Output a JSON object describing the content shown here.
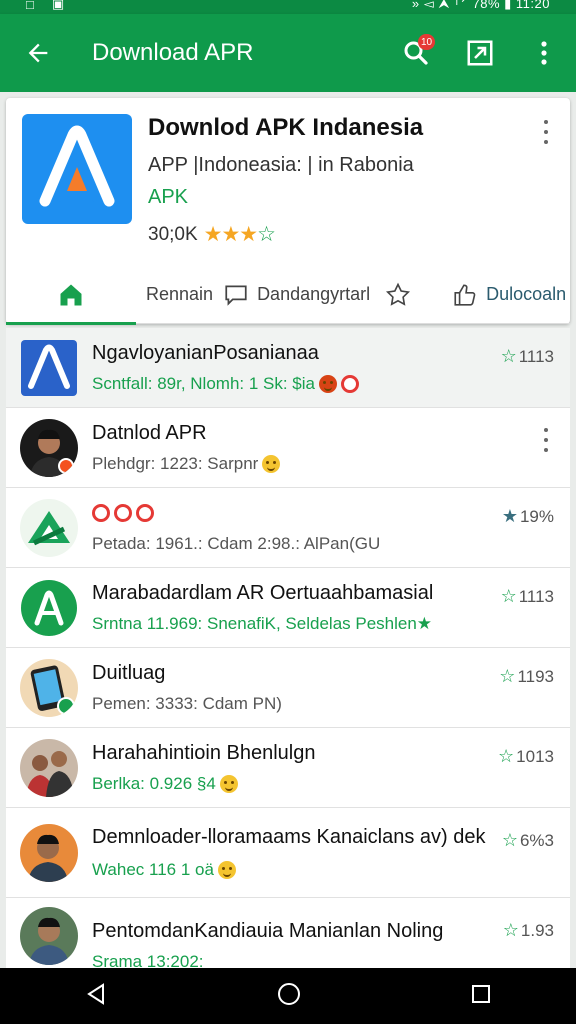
{
  "status_bar": {
    "right_text": "» ◅ ⮝ ᵀ⸍ 78% ▮ 11:20"
  },
  "appbar": {
    "title": "Download APR",
    "notification_count": "10"
  },
  "app": {
    "name": "Downlod APK Indanesia",
    "subtitle": "APP |Indoneasia: | in Rabonia",
    "category": "APK",
    "rating_text": "30;0K"
  },
  "tabs": [
    {
      "label": ""
    },
    {
      "label": "Rennain"
    },
    {
      "label": "Dandangyrtarl"
    },
    {
      "label": "Dulocoaln"
    }
  ],
  "list": [
    {
      "title": "NgavloyanianPosanianaa",
      "subtitle": "Scntfall: 89r, Nlomh: 1 Sk: $ia",
      "rating": "1113"
    },
    {
      "title": "Datnlod APR",
      "subtitle": "Plehdgr: 1223: Sarpnr"
    },
    {
      "title": "",
      "subtitle": "Petada: 1961.: Cdam 2:98.: AlPan(GU",
      "rating": "19%"
    },
    {
      "title": "Marabadardlam AR Oertuaahbamasial",
      "subtitle": "Srntna 11.969: SnenafiK, Seldelas Peshlen★",
      "rating": "1113"
    },
    {
      "title": "Duitluag",
      "subtitle": "Pemen: 3333: Cdam PN)",
      "rating": "1193"
    },
    {
      "title": "Harahahintioin Bhenlulgn",
      "subtitle": "Berlka: 0.926 §4",
      "rating": "1013"
    },
    {
      "title": "Demnloader-lloramaams Kanaiclans av) dek",
      "subtitle": "Wahec 116 1 oä",
      "rating": "6%3"
    },
    {
      "title": "PentomdanKandiauia Manianlan Noling",
      "subtitle": "Srama 13:202:",
      "rating": "1.93"
    }
  ]
}
